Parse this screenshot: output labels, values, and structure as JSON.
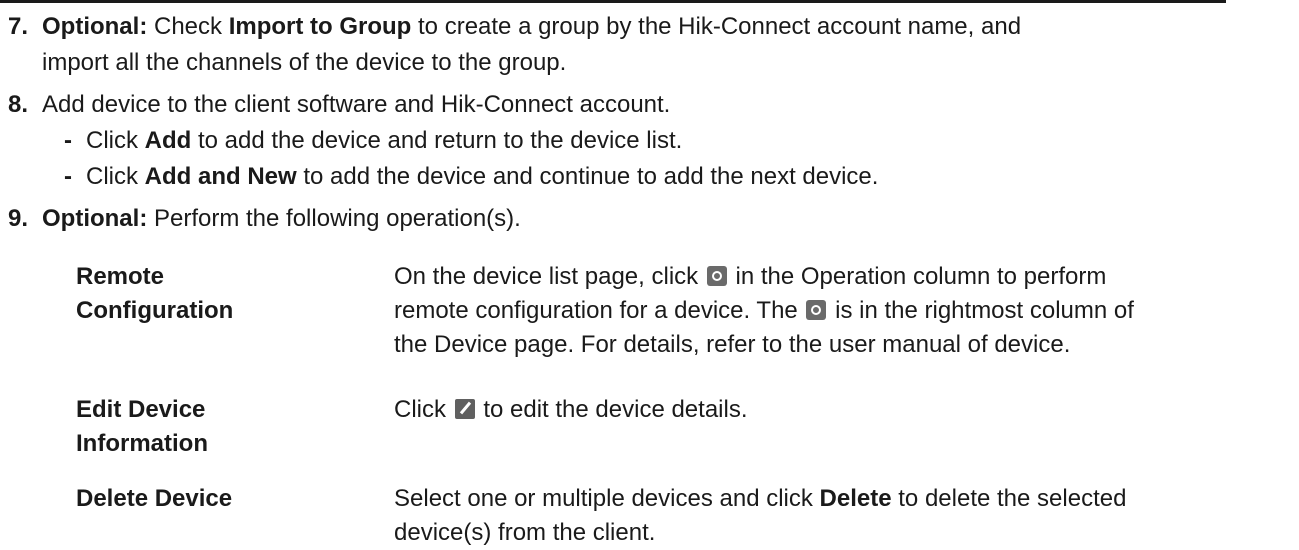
{
  "steps": [
    {
      "num": "7.",
      "parts": {
        "p1": "Optional:",
        "p2": " Check ",
        "p3": "Import to Group",
        "p4": " to create a group by the Hik-Connect account name, and"
      },
      "continuation": "import all the channels of the device to the group."
    },
    {
      "num": "8.",
      "text": "Add device to the client software and Hik-Connect account.",
      "substeps": [
        {
          "bullet": "-",
          "pre": "Click ",
          "bold": "Add",
          "post": " to add the device and return to the device list."
        },
        {
          "bullet": "-",
          "pre": "Click ",
          "bold": "Add and New",
          "post": " to add the device and continue to add the next device."
        }
      ]
    },
    {
      "num": "9.",
      "label": "Optional:",
      "text": " Perform the following operation(s)."
    }
  ],
  "operations": [
    {
      "label_line1": "Remote",
      "label_line2": "Configuration",
      "line1_pre": "On the device list page, click ",
      "line1_post": " in the Operation column to perform",
      "line2_pre": "remote configuration for a device. The ",
      "line2_post": " is in the rightmost column of",
      "line3": "the Device page. For details, refer to the user manual of device.",
      "icon": "gear-icon"
    },
    {
      "label_line1": "Edit Device",
      "label_line2": "Information",
      "pre": "Click ",
      "post": " to edit the device details.",
      "icon": "edit-icon"
    },
    {
      "label": "Delete Device",
      "pre": "Select one or multiple devices and click ",
      "bold": "Delete",
      "post": " to delete the selected",
      "line2": "device(s) from the client."
    }
  ]
}
